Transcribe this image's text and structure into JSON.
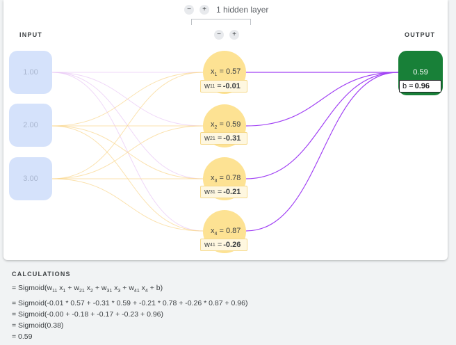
{
  "controls": {
    "layer_minus": "−",
    "layer_plus": "+",
    "layers_label": "1 hidden layer",
    "neuron_minus": "−",
    "neuron_plus": "+"
  },
  "labels": {
    "input": "INPUT",
    "output": "OUTPUT"
  },
  "inputs": [
    "1.00",
    "2.00",
    "3.00"
  ],
  "hidden": [
    {
      "x_prefix": "x",
      "x_sub": "1",
      "x_value": "= 0.57",
      "w_prefix": "w",
      "w_sub": "11",
      "w_value": "-0.01"
    },
    {
      "x_prefix": "x",
      "x_sub": "2",
      "x_value": "= 0.59",
      "w_prefix": "w",
      "w_sub": "21",
      "w_value": "-0.31"
    },
    {
      "x_prefix": "x",
      "x_sub": "3",
      "x_value": "= 0.78",
      "w_prefix": "w",
      "w_sub": "31",
      "w_value": "-0.21"
    },
    {
      "x_prefix": "x",
      "x_sub": "4",
      "x_value": "= 0.87",
      "w_prefix": "w",
      "w_sub": "41",
      "w_value": "-0.26"
    }
  ],
  "weight_eq": "=",
  "output": {
    "value": "0.59",
    "bias_label": "b =",
    "bias_value": "0.96"
  },
  "colors": {
    "input_node": "#d5e2fb",
    "hidden_node": "#fde293",
    "output_node": "#188038",
    "wire_hidden_to_output": "#a142f4",
    "wire_input_to_hidden": "#f9d58b"
  },
  "calculations": {
    "title": "CALCULATIONS",
    "formula": {
      "open": "= Sigmoid(",
      "t1": "w",
      "t1s": "11",
      "t1x": "x",
      "t1xs": "1",
      "p1": "+",
      "t2": "w",
      "t2s": "21",
      "t2x": "x",
      "t2xs": "2",
      "p2": "+",
      "t3": "w",
      "t3s": "31",
      "t3x": "x",
      "t3xs": "3",
      "p3": "+",
      "t4": "w",
      "t4s": "41",
      "t4x": "x",
      "t4xs": "4",
      "close": "+ b)"
    },
    "lines": [
      "= Sigmoid(-0.01 * 0.57 + -0.31 * 0.59 + -0.21 * 0.78 + -0.26 * 0.87 + 0.96)",
      "= Sigmoid(-0.00 + -0.18 + -0.17 + -0.23 + 0.96)",
      "= Sigmoid(0.38)",
      "= 0.59"
    ]
  }
}
